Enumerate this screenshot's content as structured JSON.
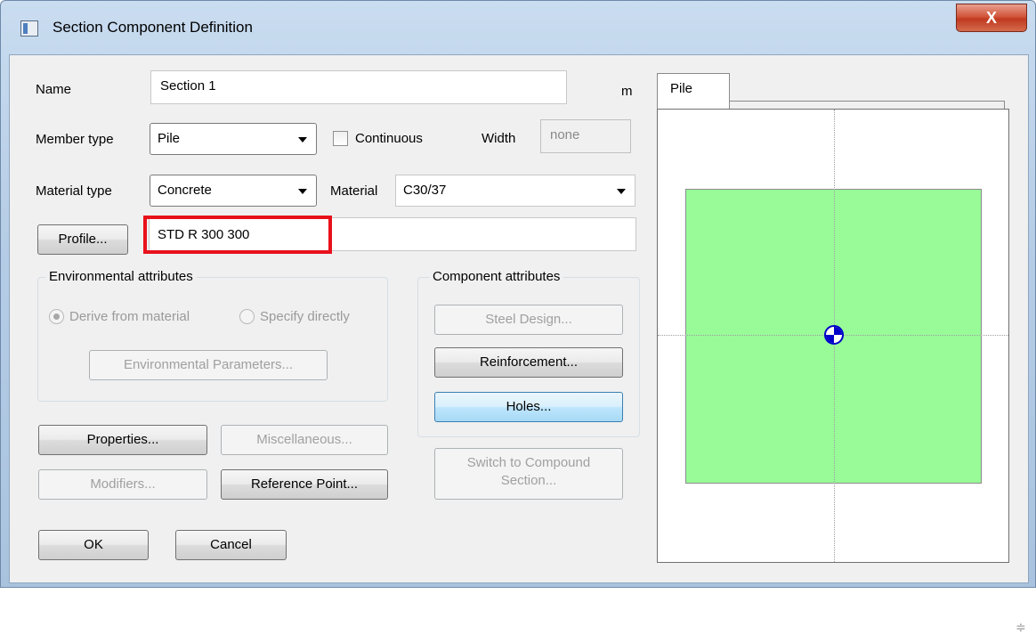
{
  "window": {
    "title": "Section Component Definition",
    "close_glyph": "X"
  },
  "form": {
    "name_label": "Name",
    "name_value": "Section 1",
    "unit_label": "m",
    "member_type_label": "Member type",
    "member_type_value": "Pile",
    "continuous_label": "Continuous",
    "continuous_checked": false,
    "width_label": "Width",
    "width_value": "none",
    "material_type_label": "Material type",
    "material_type_value": "Concrete",
    "material_label": "Material",
    "material_value": "C30/37",
    "profile_button": "Profile...",
    "profile_value": "STD R 300 300"
  },
  "environmental": {
    "title": "Environmental attributes",
    "derive_label": "Derive from material",
    "specify_label": "Specify directly",
    "selected": "derive",
    "params_button": "Environmental Parameters..."
  },
  "component": {
    "title": "Component attributes",
    "steel_design_button": "Steel Design...",
    "reinforcement_button": "Reinforcement...",
    "holes_button": "Holes...",
    "switch_button_line1": "Switch to Compound",
    "switch_button_line2": "Section..."
  },
  "buttons": {
    "properties": "Properties...",
    "miscellaneous": "Miscellaneous...",
    "modifiers": "Modifiers...",
    "reference_point": "Reference Point...",
    "ok": "OK",
    "cancel": "Cancel"
  },
  "preview": {
    "tab_label": "Pile",
    "section_fill": "#98fb98",
    "centroid_color": "#0000c8"
  },
  "colors": {
    "highlight": "#e8111b",
    "focus_button": "#bee6fd"
  }
}
